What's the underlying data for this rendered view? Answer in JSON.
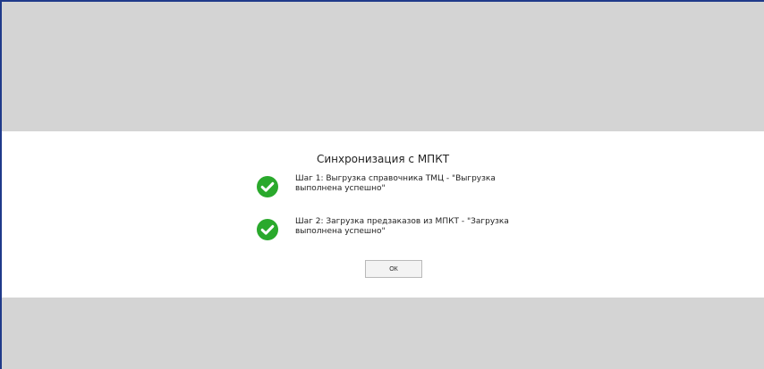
{
  "dialog": {
    "title": "Синхронизация с МПКТ",
    "steps": [
      {
        "icon": "check-circle-icon",
        "status": "success",
        "text": "Шаг 1: Выгрузка справочника ТМЦ - \"Выгрузка выполнена успешно\""
      },
      {
        "icon": "check-circle-icon",
        "status": "success",
        "text": "Шаг 2: Загрузка предзаказов из МПКТ - \"Загрузка выполнена успешно\""
      }
    ],
    "ok_label": "ОК"
  },
  "colors": {
    "overlay": "#d4d4d4",
    "dialog_background": "#ffffff",
    "success": "#2aa92c",
    "window_border": "#1f3a8a"
  }
}
